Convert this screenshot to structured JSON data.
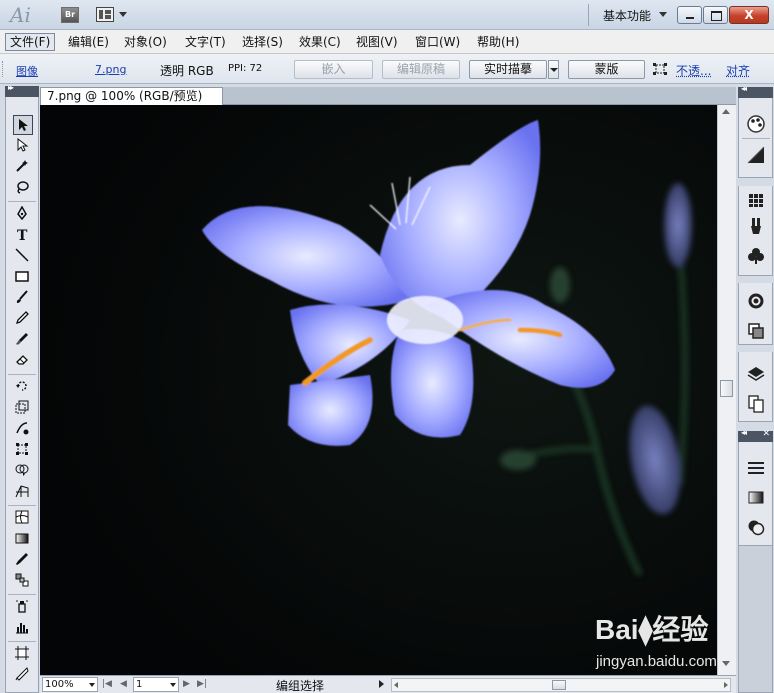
{
  "titlebar": {
    "app_logo": "Ai",
    "bridge_button": "Br",
    "workspace": "基本功能",
    "close_glyph": "X"
  },
  "menubar": {
    "items": [
      {
        "label": "文件(F)"
      },
      {
        "label": "编辑(E)"
      },
      {
        "label": "对象(O)"
      },
      {
        "label": "文字(T)"
      },
      {
        "label": "选择(S)"
      },
      {
        "label": "效果(C)"
      },
      {
        "label": "视图(V)"
      },
      {
        "label": "窗口(W)"
      },
      {
        "label": "帮助(H)"
      }
    ]
  },
  "controlbar": {
    "object_type": "图像",
    "filename": "7.png",
    "color_mode": "透明 RGB",
    "ppi": "PPI: 72",
    "embed_button": "嵌入",
    "edit_original_button": "编辑原稿",
    "live_trace_button": "实时描摹",
    "mask_button": "蒙版",
    "opacity_link": "不透...",
    "align_link": "对齐"
  },
  "document": {
    "tab_title": "7.png @ 100% (RGB/预览)",
    "tab_close": "✕"
  },
  "statusbar": {
    "zoom": "100%",
    "page": "1",
    "status": "编组选择"
  },
  "watermark": {
    "logo": "Bai⧫经验",
    "url": "jingyan.baidu.com"
  },
  "image": {
    "description_colors": {
      "background": "#050607",
      "petal": "#8f97ff",
      "petal_center": "#e4e8ff",
      "accent": "#f09a22"
    }
  }
}
